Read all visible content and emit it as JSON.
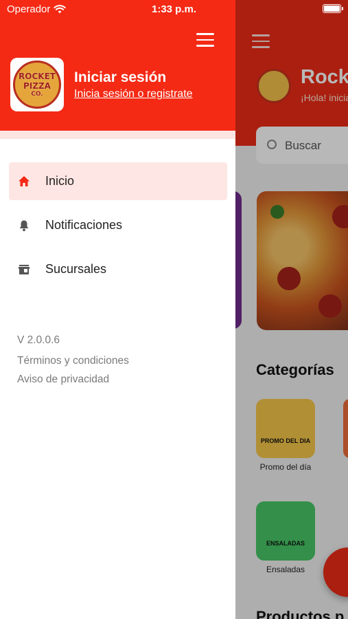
{
  "status_bar": {
    "carrier": "Operador",
    "time": "1:33 p.m."
  },
  "drawer": {
    "signin_title": "Iniciar sesión",
    "signin_link": "Inicia sesión o registrate",
    "logo_text": [
      "ROCKET",
      "PIZZA",
      "CO."
    ],
    "menu_items": [
      {
        "label": "Inicio",
        "icon": "home-icon",
        "active": true
      },
      {
        "label": "Notificaciones",
        "icon": "bell-icon",
        "active": false
      },
      {
        "label": "Sucursales",
        "icon": "store-icon",
        "active": false
      }
    ],
    "version": "V 2.0.0.6",
    "terms": "Términos y condiciones",
    "privacy": "Aviso de privacidad"
  },
  "background": {
    "title": "Rock",
    "subtitle": "¡Hola! inicia",
    "search_placeholder": "Buscar",
    "categories_title": "Categorías",
    "categories": [
      {
        "badge": "PROMO DEL DIA",
        "label": "Promo del día",
        "color": "#f6c74a"
      },
      {
        "badge": "ENSALADAS",
        "label": "Ensaladas",
        "color": "#47c766"
      }
    ],
    "bottom_title": "Productos p"
  },
  "colors": {
    "brand_red": "#f42a15",
    "active_bg": "#fde6e3"
  }
}
